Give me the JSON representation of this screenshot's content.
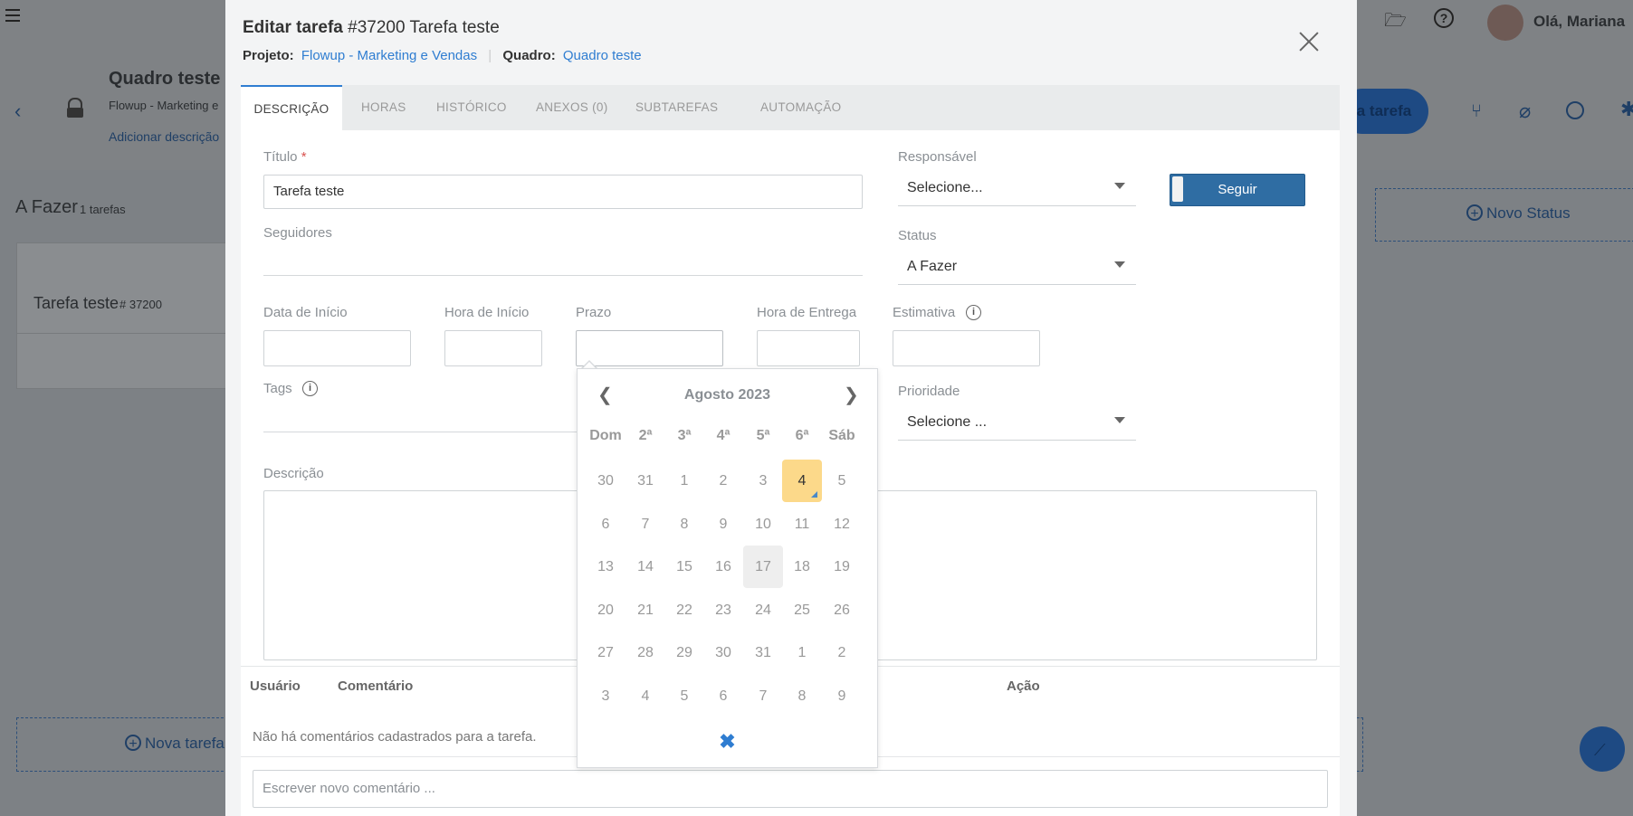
{
  "background": {
    "greeting": "Olá, Mariana",
    "board_title": "Quadro teste",
    "board_subtitle": "Flowup - Marketing e",
    "add_description": "Adicionar descrição",
    "new_task_btn": "a tarefa",
    "column_title": "A Fazer",
    "column_count": "1 tarefas",
    "card_title": "Tarefa teste",
    "card_id": "# 37200",
    "new_status": "Novo Status",
    "new_task_bottom": "Nova tarefa"
  },
  "modal": {
    "title_bold": "Editar tarefa",
    "title_rest": "#37200 Tarefa teste",
    "project_label": "Projeto:",
    "project_value": "Flowup - Marketing e Vendas",
    "separator": "|",
    "board_label": "Quadro:",
    "board_value": "Quadro teste",
    "tabs": [
      {
        "label": "DESCRIÇÃO"
      },
      {
        "label": "HORAS"
      },
      {
        "label": "HISTÓRICO"
      },
      {
        "label": "ANEXOS (0)"
      },
      {
        "label": "SUBTAREFAS"
      },
      {
        "label": "AUTOMAÇÃO"
      }
    ]
  },
  "form": {
    "title_label": "Título",
    "required_mark": "*",
    "title_value": "Tarefa teste",
    "followers_label": "Seguidores",
    "start_date_label": "Data de Início",
    "start_time_label": "Hora de Início",
    "deadline_label": "Prazo",
    "delivery_time_label": "Hora de Entrega",
    "estimate_label": "Estimativa",
    "tags_label": "Tags",
    "description_label": "Descrição",
    "responsible_label": "Responsável",
    "responsible_value": "Selecione...",
    "follow_button": "Seguir",
    "status_label": "Status",
    "status_value": "A Fazer",
    "priority_label": "Prioridade",
    "priority_value": "Selecione ..."
  },
  "datepicker": {
    "month_label": "Agosto 2023",
    "weekdays": [
      "Dom",
      "2ª",
      "3ª",
      "4ª",
      "5ª",
      "6ª",
      "Sáb"
    ],
    "weeks": [
      [
        "30",
        "31",
        "1",
        "2",
        "3",
        "4",
        "5"
      ],
      [
        "6",
        "7",
        "8",
        "9",
        "10",
        "11",
        "12"
      ],
      [
        "13",
        "14",
        "15",
        "16",
        "17",
        "18",
        "19"
      ],
      [
        "20",
        "21",
        "22",
        "23",
        "24",
        "25",
        "26"
      ],
      [
        "27",
        "28",
        "29",
        "30",
        "31",
        "1",
        "2"
      ],
      [
        "3",
        "4",
        "5",
        "6",
        "7",
        "8",
        "9"
      ]
    ],
    "today": "4",
    "hovered": "17",
    "prev_icon": "chevron-left-icon",
    "next_icon": "chevron-right-icon",
    "clear_icon": "close-icon"
  },
  "comments": {
    "user_header": "Usuário",
    "comment_header": "Comentário",
    "action_header": "Ação",
    "empty_message": "Não há comentários cadastrados para a tarefa.",
    "new_comment_placeholder": "Escrever novo comentário ..."
  },
  "colors": {
    "accent": "#2f7dd1",
    "follow_button": "#2f6da3",
    "today_highlight": "#fcd98a"
  }
}
